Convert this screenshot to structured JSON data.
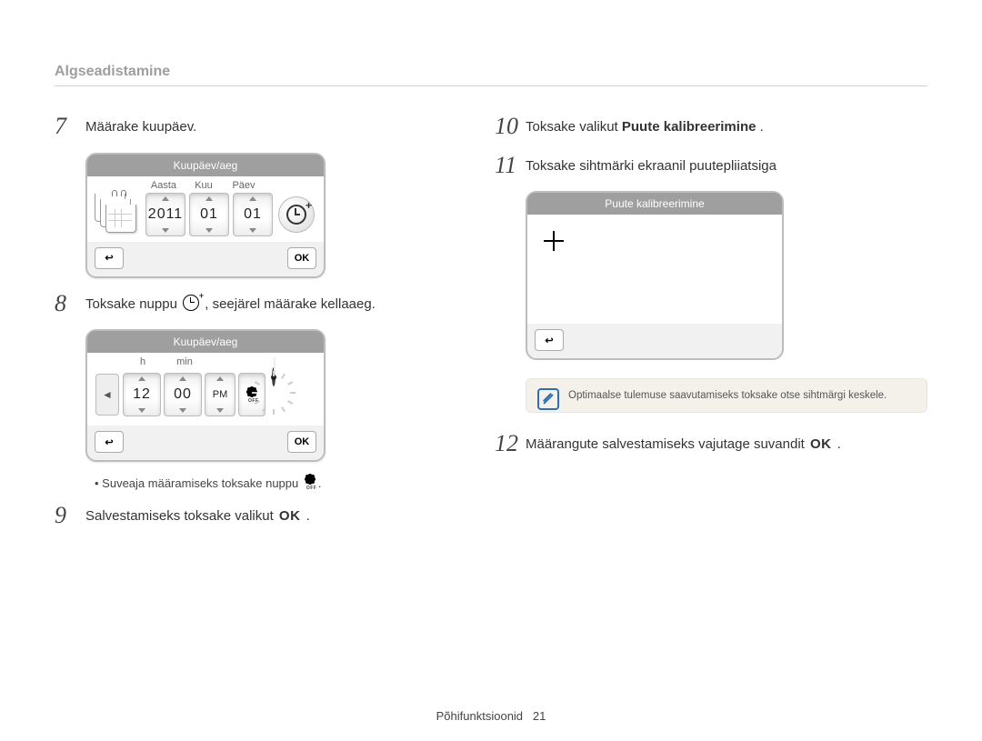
{
  "section_title": "Algseadistamine",
  "footer": {
    "label": "Põhifunktsioonid",
    "page": "21"
  },
  "left": {
    "step7": {
      "num": "7",
      "text": "Määrake kuupäev."
    },
    "date_panel": {
      "header": "Kuupäev/aeg",
      "labels": {
        "year": "Aasta",
        "month": "Kuu",
        "day": "Päev"
      },
      "values": {
        "year": "2011",
        "month": "01",
        "day": "01"
      },
      "buttons": {
        "back_glyph": "↩",
        "ok": "OK"
      },
      "icons": {
        "calendar": "calendar-icon",
        "clock_plus": "clock-plus-icon"
      }
    },
    "step8": {
      "num": "8",
      "text_before": "Toksake nuppu ",
      "text_after": ", seejärel määrake kellaaeg."
    },
    "time_panel": {
      "header": "Kuupäev/aeg",
      "labels": {
        "hour": "h",
        "min": "min"
      },
      "values": {
        "hour": "12",
        "min": "00",
        "ampm": "PM"
      },
      "buttons": {
        "back_glyph": "↩",
        "ok": "OK",
        "left_glyph": "◄"
      },
      "icons": {
        "dst": "dst-icon",
        "analog_clock": "analog-clock-icon"
      }
    },
    "dst_note": "Suveaja määramiseks toksake nuppu ",
    "step9": {
      "num": "9",
      "text_before": "Salvestamiseks toksake valikut ",
      "ok": "OK",
      "text_after": "."
    }
  },
  "right": {
    "step10": {
      "num": "10",
      "text_before": "Toksake valikut ",
      "bold": "Puute kalibreerimine",
      "text_after": "."
    },
    "step11": {
      "num": "11",
      "text": "Toksake sihtmärki ekraanil puutepliiatsiga"
    },
    "calib_panel": {
      "header": "Puute kalibreerimine",
      "back_glyph": "↩",
      "target_icon": "crosshair-icon"
    },
    "info_text": "Optimaalse tulemuse saavutamiseks toksake otse sihtmärgi keskele.",
    "step12": {
      "num": "12",
      "text_before": "Määrangute salvestamiseks vajutage suvandit ",
      "ok": "OK",
      "text_after": "."
    }
  }
}
